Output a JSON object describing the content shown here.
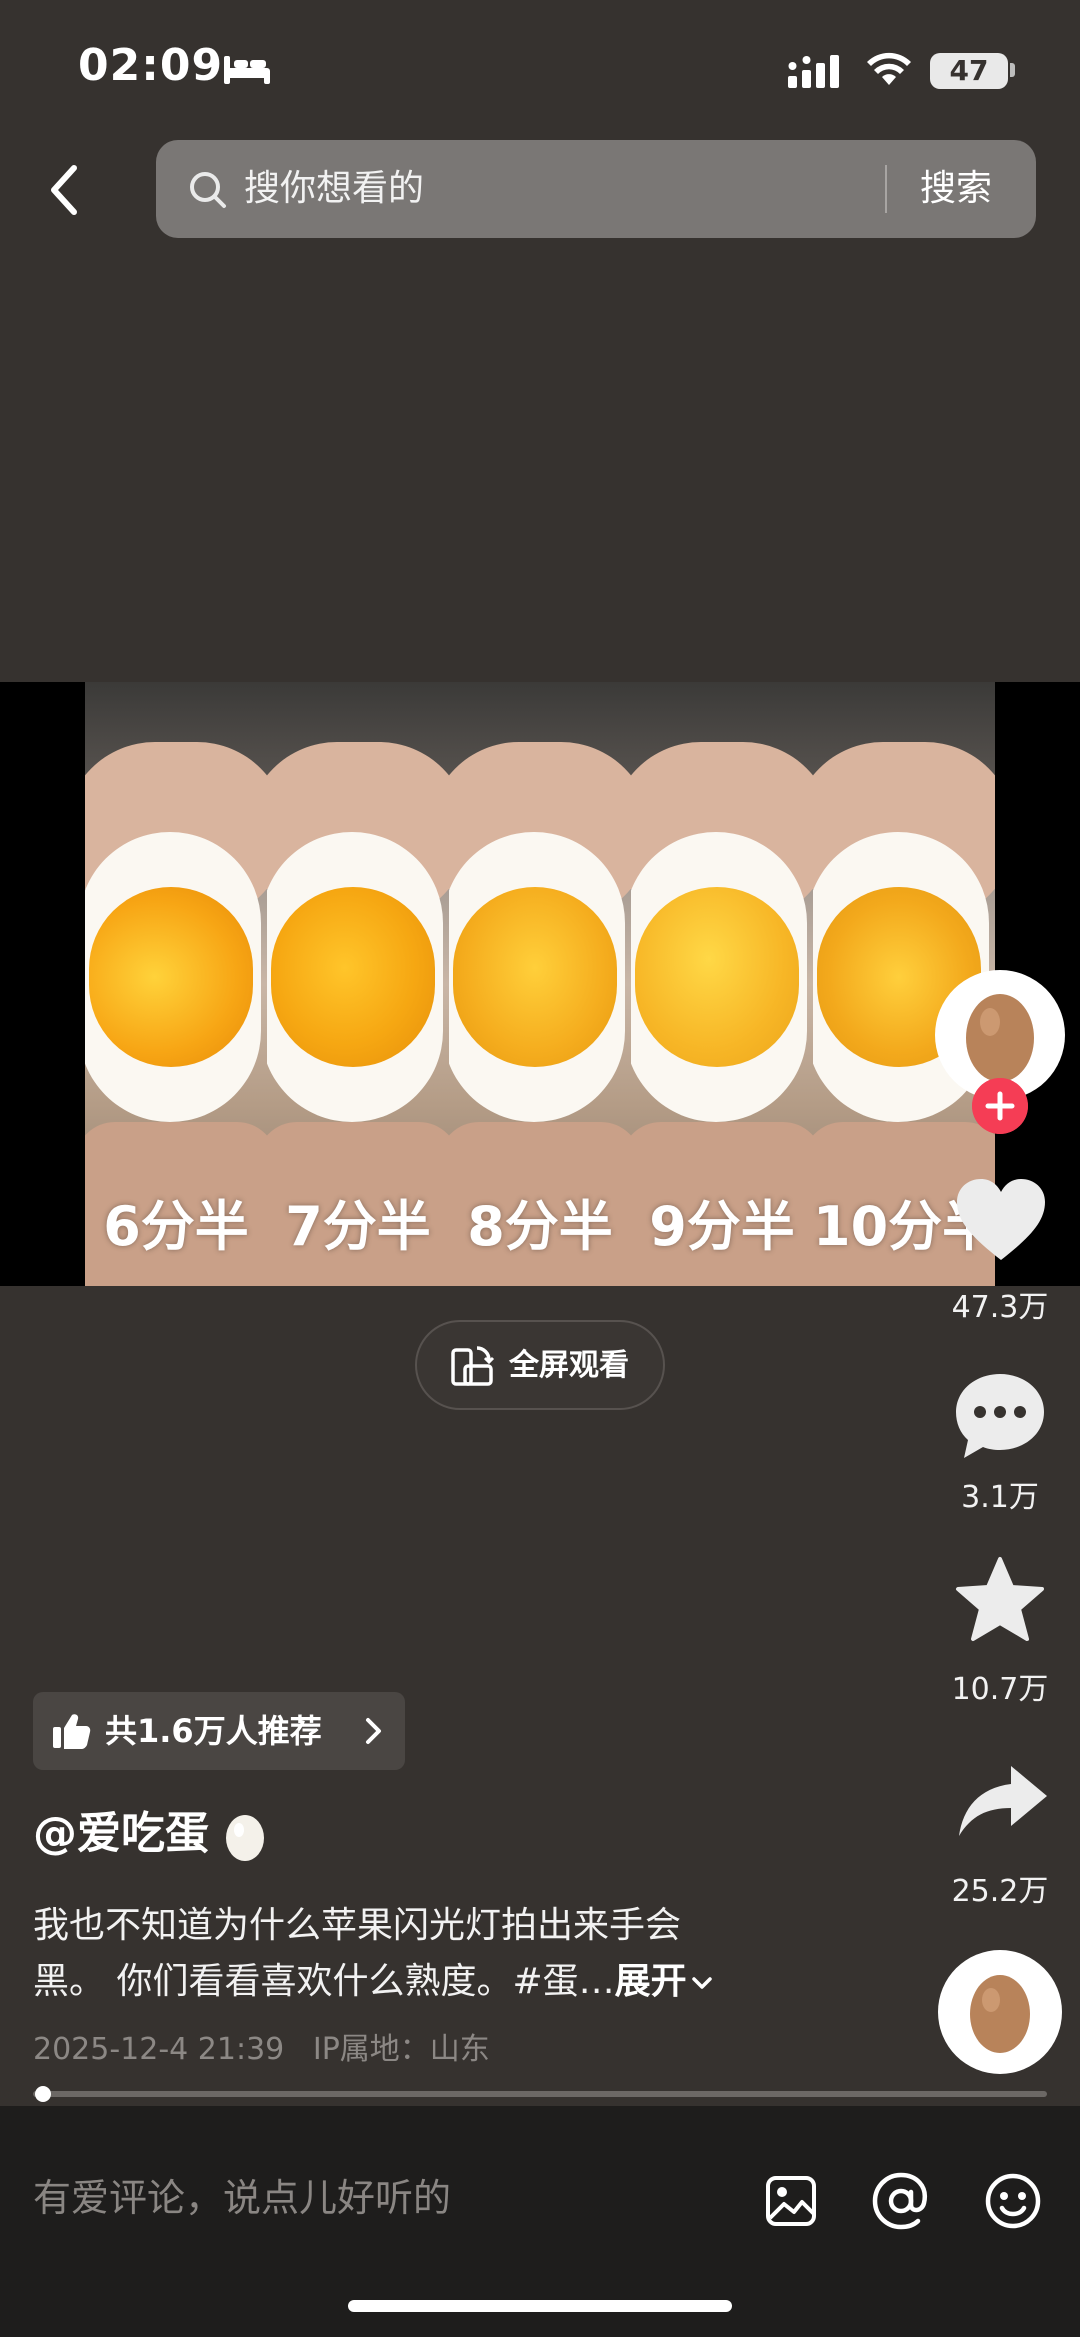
{
  "status_bar": {
    "time": "02:09",
    "battery": "47",
    "icons": [
      "bed-icon",
      "signal-icon",
      "wifi-icon",
      "battery-icon"
    ]
  },
  "search": {
    "placeholder": "搜你想看的",
    "button_label": "搜索"
  },
  "video": {
    "panels": [
      {
        "label": "6分半"
      },
      {
        "label": "7分半"
      },
      {
        "label": "8分半"
      },
      {
        "label": "9分半"
      },
      {
        "label": "10分半"
      }
    ],
    "fullscreen_label": "全屏观看"
  },
  "actions": {
    "like_count": "47.3万",
    "comment_count": "3.1万",
    "favorite_count": "10.7万",
    "share_count": "25.2万"
  },
  "post": {
    "recommend_label": "共1.6万人推荐",
    "author": "@爱吃蛋",
    "caption_line1": "我也不知道为什么苹果闪光灯拍出来手会",
    "caption_line2": "黑。 你们看看喜欢什么熟度。#蛋…",
    "expand_label": "展开",
    "date": "2025-12-4 21:39",
    "ip_location": "IP属地：山东",
    "progress": 0.01
  },
  "comment_bar": {
    "placeholder": "有爱评论，说点儿好听的",
    "icons": [
      "image-icon",
      "at-icon",
      "emoji-icon"
    ]
  },
  "colors": {
    "background": "#36322f",
    "accent_follow": "#f53d55",
    "yolk": "#f6a712"
  }
}
